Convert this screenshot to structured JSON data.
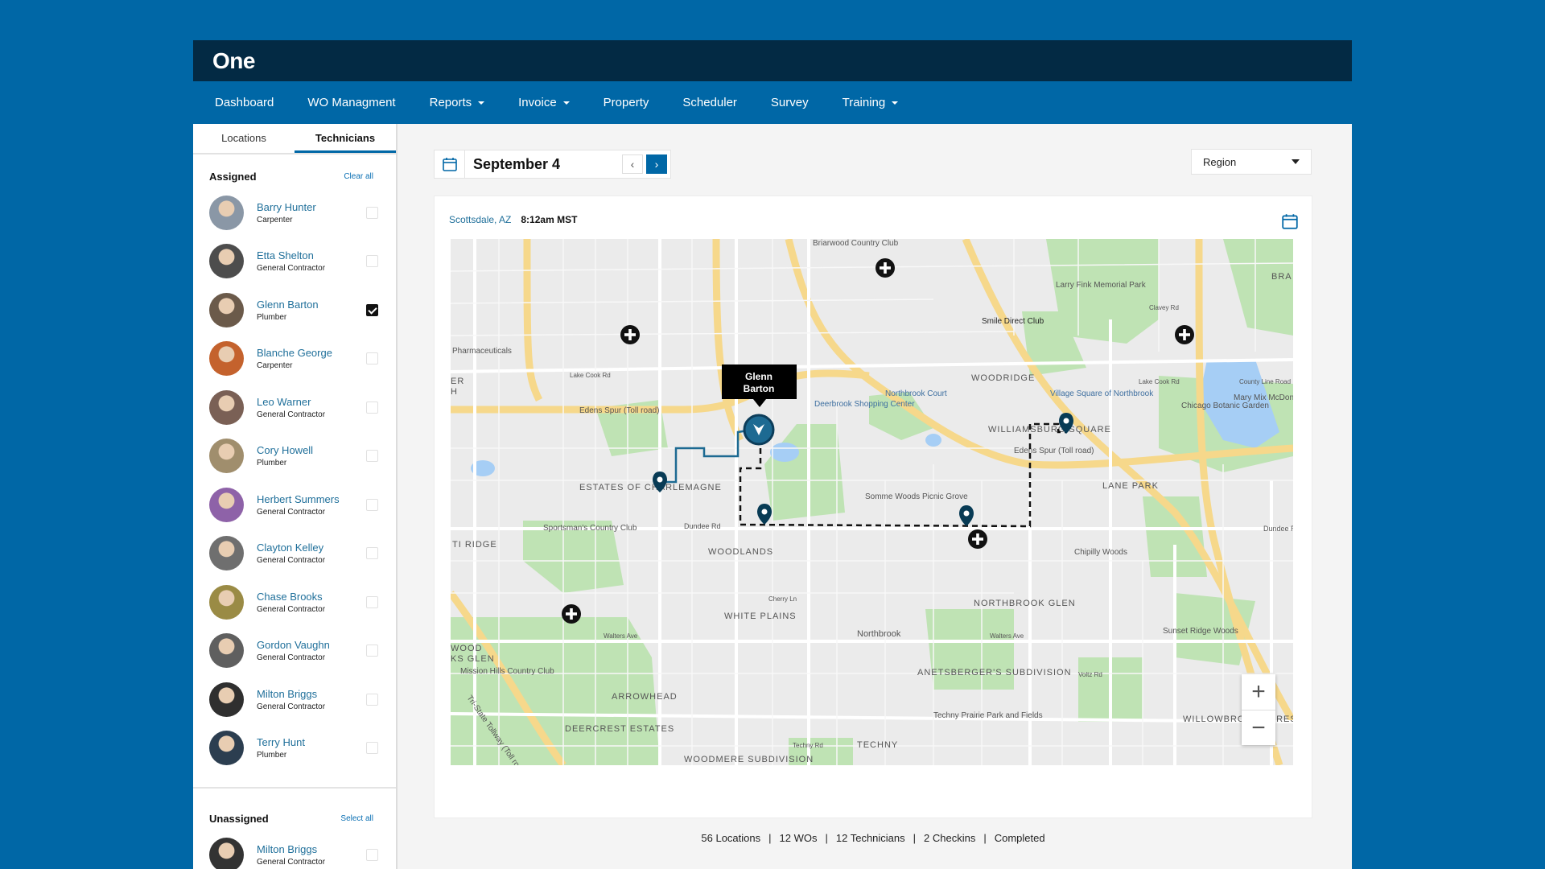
{
  "app": {
    "logo": "One"
  },
  "nav": [
    {
      "label": "Dashboard",
      "dropdown": false
    },
    {
      "label": "WO Managment",
      "dropdown": false
    },
    {
      "label": "Reports",
      "dropdown": true
    },
    {
      "label": "Invoice",
      "dropdown": true
    },
    {
      "label": "Property",
      "dropdown": false
    },
    {
      "label": "Scheduler",
      "dropdown": false
    },
    {
      "label": "Survey",
      "dropdown": false
    },
    {
      "label": "Training",
      "dropdown": true
    }
  ],
  "sidebar": {
    "tabs": [
      "Locations",
      "Technicians"
    ],
    "active_tab": "Technicians",
    "assigned": {
      "title": "Assigned",
      "action": "Clear all",
      "items": [
        {
          "name": "Barry Hunter",
          "role": "Carpenter",
          "checked": false,
          "color": "#8a97a6"
        },
        {
          "name": "Etta Shelton",
          "role": "General Contractor",
          "checked": false,
          "color": "#4d4d4d"
        },
        {
          "name": "Glenn Barton",
          "role": "Plumber",
          "checked": true,
          "color": "#6b5a4a"
        },
        {
          "name": "Blanche George",
          "role": "Carpenter",
          "checked": false,
          "color": "#c4622d"
        },
        {
          "name": "Leo Warner",
          "role": "General Contractor",
          "checked": false,
          "color": "#7a6055"
        },
        {
          "name": "Cory Howell",
          "role": "Plumber",
          "checked": false,
          "color": "#a08e6d"
        },
        {
          "name": "Herbert Summers",
          "role": "General Contractor",
          "checked": false,
          "color": "#8e62a8"
        },
        {
          "name": "Clayton Kelley",
          "role": "General Contractor",
          "checked": false,
          "color": "#6f6f6f"
        },
        {
          "name": "Chase Brooks",
          "role": "General Contractor",
          "checked": false,
          "color": "#9a8b45"
        },
        {
          "name": "Gordon Vaughn",
          "role": "General Contractor",
          "checked": false,
          "color": "#5f5f5f"
        },
        {
          "name": "Milton Briggs",
          "role": "General Contractor",
          "checked": false,
          "color": "#2f2f2f"
        },
        {
          "name": "Terry Hunt",
          "role": "Plumber",
          "checked": false,
          "color": "#2c3e50"
        }
      ]
    },
    "unassigned": {
      "title": "Unassigned",
      "action": "Select all",
      "items": [
        {
          "name": "Milton Briggs",
          "role": "General Contractor",
          "checked": false,
          "color": "#333333"
        }
      ]
    }
  },
  "toolbar": {
    "date": "September 4",
    "prev": "‹",
    "next": "›",
    "region": "Region"
  },
  "card": {
    "location": "Scottsdale, AZ",
    "time": "8:12am MST"
  },
  "map": {
    "tooltip": [
      "Glenn",
      "Barton"
    ],
    "labels": {
      "briarwood": "Briarwood Country Club",
      "larry_fink": "Larry Fink Memorial Park",
      "smile": "Smile Direct Club",
      "pharma": "Pharmaceuticals",
      "woodridge": "WOODRIDGE",
      "northbrook_court": "Northbrook Court",
      "village_square": "Village Square of Northbrook",
      "chicago_botanic": "Chicago Botanic Garden",
      "mary_mix": "Mary Mix McDonald Woods",
      "deerbrook": "Deerbrook Shopping Center",
      "edens_spur_w": "Edens Spur (Toll road)",
      "edens_spur_e": "Edens Spur (Toll road)",
      "williams_square": "WILLIAMSBURG SQUARE",
      "lane_park": "LANE PARK",
      "estates": "ESTATES OF CHARLEMAGNE",
      "somme": "Somme Woods Picnic Grove",
      "sportsmans": "Sportsman's Country Club",
      "woodlands": "WOODLANDS",
      "chipilly": "Chipilly Woods",
      "ti_ridge": "TI RIDGE",
      "dundee_w": "Dundee Rd",
      "dundee_e": "Dundee Rd",
      "white_plains": "WHITE PLAINS",
      "northbrook_glen": "NORTHBROOK GLEN",
      "sunset_ridge": "Sunset Ridge Woods",
      "mission_hills": "Mission Hills Country Club",
      "arrowhead": "ARROWHEAD",
      "anetsberger": "ANETSBERGER'S SUBDIVISION",
      "techny_prairie": "Techny Prairie Park and Fields",
      "deercrest": "DEERCREST ESTATES",
      "techny": "TECHNY",
      "willowbrook": "WILLOWBROOK ACRES",
      "woodmere": "WOODMERE SUBDIVISION",
      "northbrook": "Northbrook",
      "tristate": "Tri-State Tollway (Toll road)",
      "lake_cook_w": "Lake Cook Rd",
      "lake_cook_e": "Lake Cook Rd",
      "clavey": "Clavey Rd",
      "walters_w": "Walters Ave",
      "walters_e": "Walters Ave",
      "cherry": "Cherry Ln",
      "techny_rd": "Techny Rd",
      "voltz": "Voltz Rd",
      "wood": "WOOD",
      "ks_glen": "KS GLEN",
      "er": "ER",
      "h": "H",
      "bra": "BRA",
      "county_line": "County Line Road"
    },
    "zoom_in": "+",
    "zoom_out": "−"
  },
  "stats": [
    "56 Locations",
    "12 WOs",
    "12 Technicians",
    "2 Checkins",
    "Completed"
  ]
}
